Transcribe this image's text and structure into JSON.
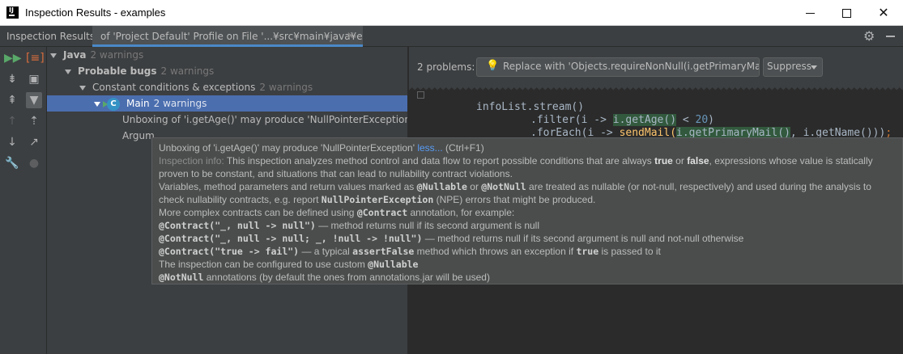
{
  "window": {
    "title": "Inspection Results - examples",
    "app_icon": "intellij-icon",
    "controls": [
      "minimize-icon",
      "maximize-icon",
      "close-icon"
    ]
  },
  "tool_header": {
    "label": "Inspection Results:",
    "tab_label": "of 'Project Default' Profile on File '...¥src¥main¥java¥exa...",
    "tab_close": "✕"
  },
  "toolbar_icons": [
    "rerun-icon",
    "export-icon",
    "expand-all-icon",
    "group-icon",
    "collapse-all-icon",
    "filter-icon",
    "prev-icon",
    "autoscroll-icon",
    "next-icon",
    "open-source-icon",
    "settings-wrench-icon",
    "bulb-icon"
  ],
  "tree": [
    {
      "label": "Java",
      "warnings": "2 warnings"
    },
    {
      "label": "Probable bugs",
      "warnings": "2 warnings"
    },
    {
      "label": "Constant conditions & exceptions",
      "warnings": "2 warnings"
    },
    {
      "label": "Main",
      "warnings": "2 warnings"
    },
    {
      "label": "Unboxing of 'i.getAge()' may produce 'NullPointerException'"
    },
    {
      "label": "Argum"
    }
  ],
  "problems": {
    "count": "2 problems:",
    "fix_label": "Replace with 'Objects.requireNonNull(i.getPrimaryMail())'",
    "suppress_label": "Suppress"
  },
  "code": {
    "line1": "infoList.stream()",
    "line2_pre": ".filter(i -> ",
    "line2_hl": "i.getAge()",
    "line2_op": " < ",
    "line2_num": "20",
    "line2_post": ")",
    "line3_pre": ".forEach(i -> ",
    "line3_send": "sendMail(",
    "line3_arg": "i.getPrimaryMail()",
    "line3_post": ", i.getName()))",
    "line3_semi": ";"
  },
  "tooltip": {
    "title": "Unboxing of 'i.getAge()' may produce 'NullPointerException'",
    "more_link": "less...",
    "shortcut": "(Ctrl+F1)",
    "info_label": "Inspection info:",
    "info_a": "This inspection analyzes method control and data flow to report possible conditions that are always",
    "kw_true": "true",
    "or_word": "or",
    "kw_false": "false",
    "info_b": ", expressions whose value is statically",
    "info_line2": "proven to be constant, and situations that can lead to nullability contract violations.",
    "var_a": "Variables, method parameters and return values marked as",
    "ann_nullable": "@Nullable",
    "var_or": "or",
    "ann_notnull": "@NotNull",
    "var_b": "are treated as nullable (or not-null, respectively) and used during the analysis to",
    "check_a": "check nullability contracts, e.g. report",
    "npe_code": "NullPointerException",
    "check_b": "(NPE) errors that might be produced.",
    "more_a": "More complex contracts can be defined using",
    "ann_contract": "@Contract",
    "more_b": "annotation, for example:",
    "ex1_code": "@Contract(\"_, null -> null\")",
    "ex1_text": "— method returns null if its second argument is null",
    "ex2_code": "@Contract(\"_, null -> null; _, !null -> !null\")",
    "ex2_text": "— method returns null if its second argument is null and not-null otherwise",
    "ex3_code": "@Contract(\"true -> fail\")",
    "ex3_text_a": "— a typical",
    "ex3_method": "assertFalse",
    "ex3_text_b": "method which throws an exception if",
    "ex3_true": "true",
    "ex3_text_c": "is passed to it",
    "config_a": "The inspection can be configured to use custom",
    "config_ann": "@Nullable",
    "last_ann": "@NotNull",
    "last_text": "annotations (by default the ones from annotations.jar will be used)"
  }
}
